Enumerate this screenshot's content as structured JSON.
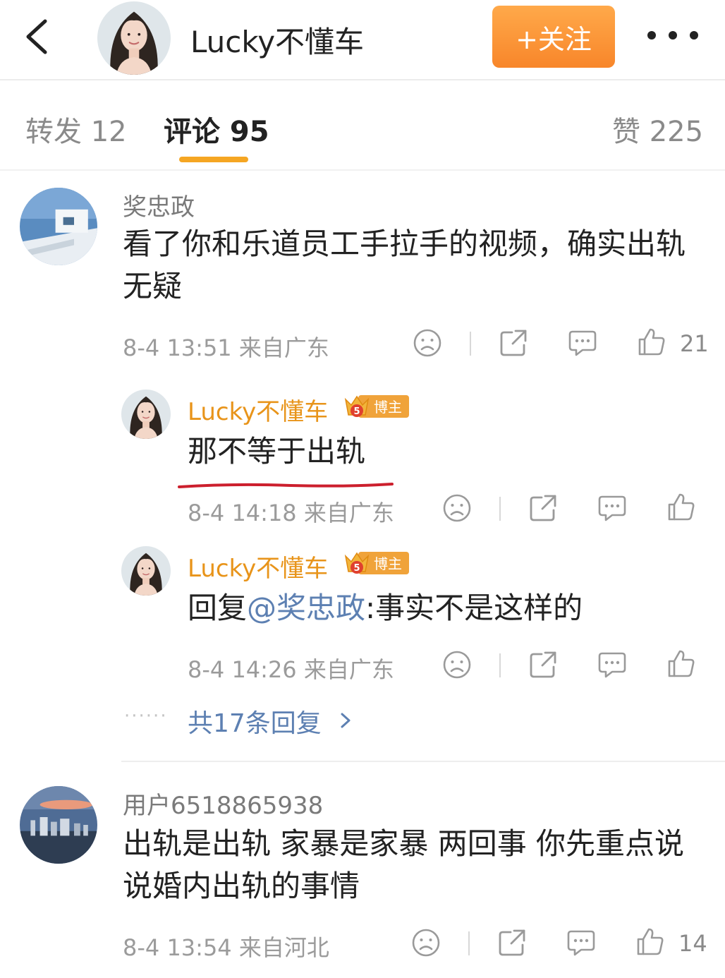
{
  "header": {
    "name": "Lucky不懂车",
    "follow_label": "+关注"
  },
  "tabs": {
    "repost": "转发 12",
    "comment": "评论 95",
    "like": "赞 225"
  },
  "comments": [
    {
      "user": "奖忠政",
      "text": "看了你和乐道员工手拉手的视频，确实出轨无疑",
      "meta": "8-4 13:51  来自广东",
      "likes": "21",
      "replies": [
        {
          "user": "Lucky不懂车",
          "badge": "博主",
          "badge_level": "5",
          "text": "那不等于出轨",
          "meta": "8-4 14:18  来自广东"
        },
        {
          "user": "Lucky不懂车",
          "badge": "博主",
          "badge_level": "5",
          "reply_prefix": "回复",
          "mention": "@奖忠政",
          "text": ":事实不是这样的",
          "meta": "8-4 14:26  来自广东"
        }
      ],
      "more_replies": "共17条回复"
    },
    {
      "user": "用户6518865938",
      "text": "出轨是出轨 家暴是家暴 两回事 你先重点说说婚内出轨的事情",
      "meta": "8-4 13:54  来自河北",
      "likes": "14"
    }
  ],
  "colors": {
    "accent_orange": "#f8862a",
    "blogger_name": "#e8941a",
    "link_blue": "#5d80b2",
    "tab_indicator": "#f5a623",
    "red_underline": "#cc1f2d"
  }
}
